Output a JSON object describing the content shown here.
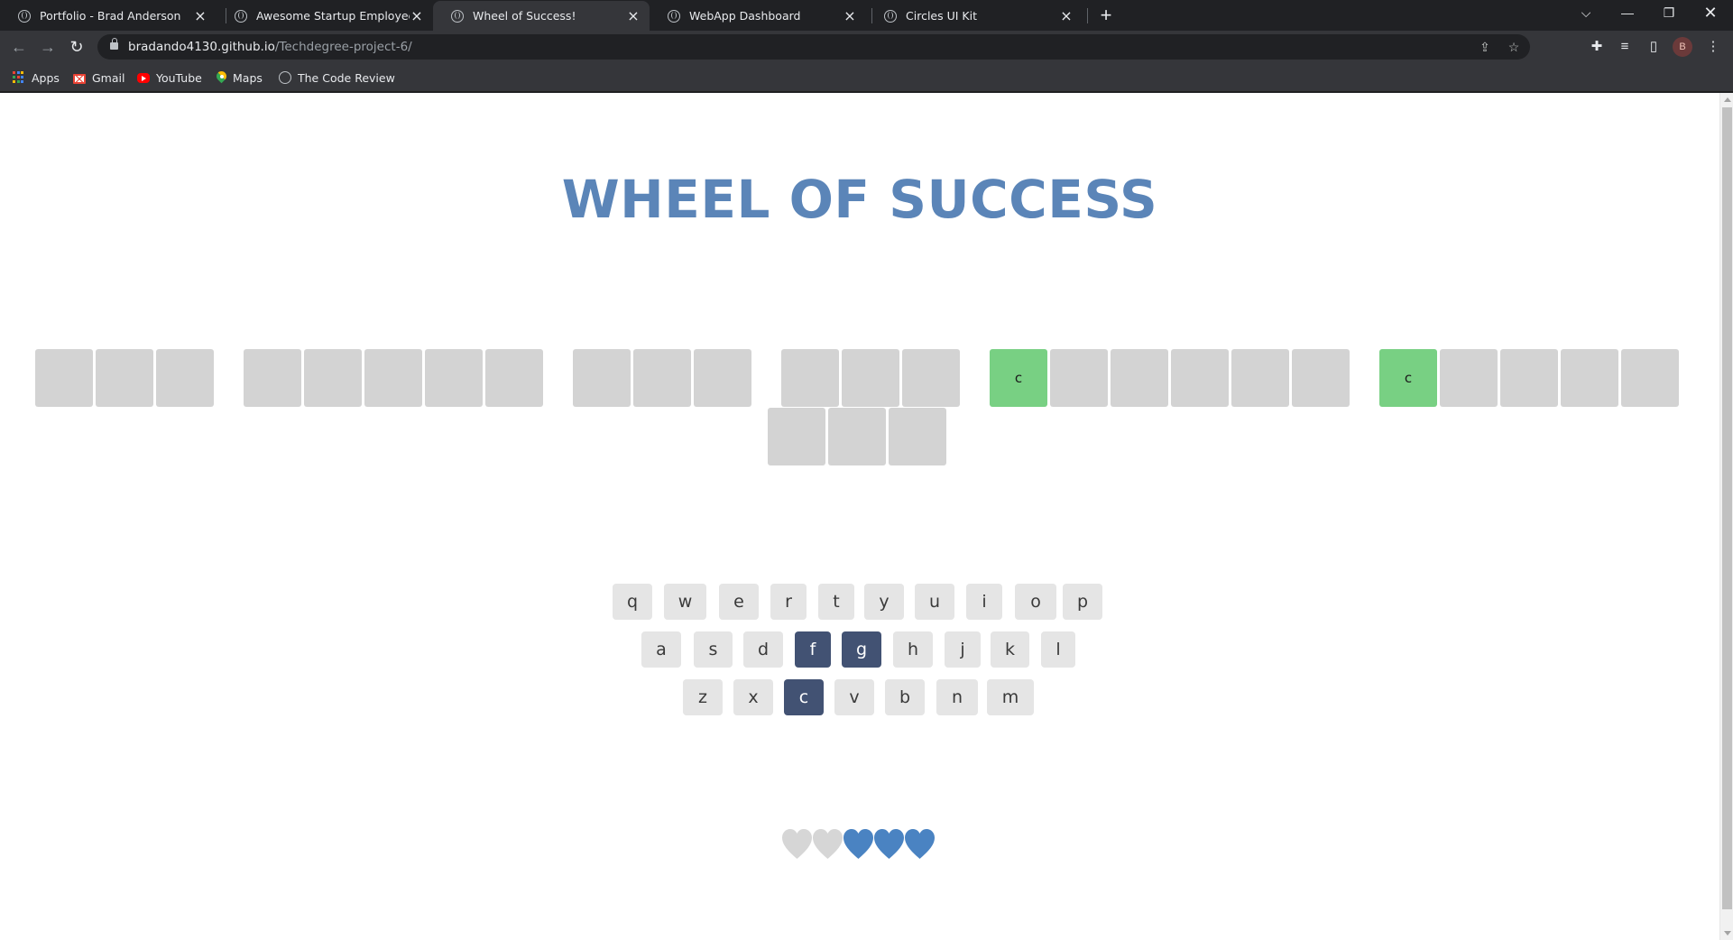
{
  "browser": {
    "tabs": [
      {
        "title": "Portfolio - Brad Anderson",
        "active": false
      },
      {
        "title": "Awesome Startup Employee Dire",
        "active": false
      },
      {
        "title": "Wheel of Success!",
        "active": true
      },
      {
        "title": "WebApp Dashboard",
        "active": false
      },
      {
        "title": "Circles UI Kit",
        "active": false
      }
    ],
    "url_host": "bradando4130.github.io",
    "url_path": "/Techdegree-project-6/",
    "profile_initial": "B",
    "bookmarks": [
      {
        "label": "Apps",
        "icon": "apps-grid-icon"
      },
      {
        "label": "Gmail",
        "icon": "gmail-icon"
      },
      {
        "label": "YouTube",
        "icon": "youtube-icon"
      },
      {
        "label": "Maps",
        "icon": "maps-icon"
      },
      {
        "label": "The Code Review",
        "icon": "globe-icon"
      }
    ]
  },
  "page": {
    "title": "WHEEL OF SUCCESS",
    "phrase": {
      "words": [
        [
          "",
          "",
          ""
        ],
        [
          "",
          "",
          "",
          "",
          ""
        ],
        [
          "",
          "",
          ""
        ],
        [
          "",
          "",
          ""
        ],
        [
          "c",
          "",
          "",
          "",
          "",
          ""
        ],
        [
          "c",
          "",
          "",
          "",
          ""
        ],
        [
          "",
          "",
          ""
        ]
      ]
    },
    "keyboard": {
      "rows": [
        [
          "q",
          "w",
          "e",
          "r",
          "t",
          "y",
          "u",
          "i",
          "o",
          "p"
        ],
        [
          "a",
          "s",
          "d",
          "f",
          "g",
          "h",
          "j",
          "k",
          "l"
        ],
        [
          "z",
          "x",
          "c",
          "v",
          "b",
          "n",
          "m"
        ]
      ],
      "chosen": [
        "f",
        "g",
        "c"
      ]
    },
    "scoreboard": {
      "lost_hearts": 2,
      "live_hearts": 3,
      "live_color": "#4a83c2",
      "lost_color": "#d6d6d6"
    }
  }
}
